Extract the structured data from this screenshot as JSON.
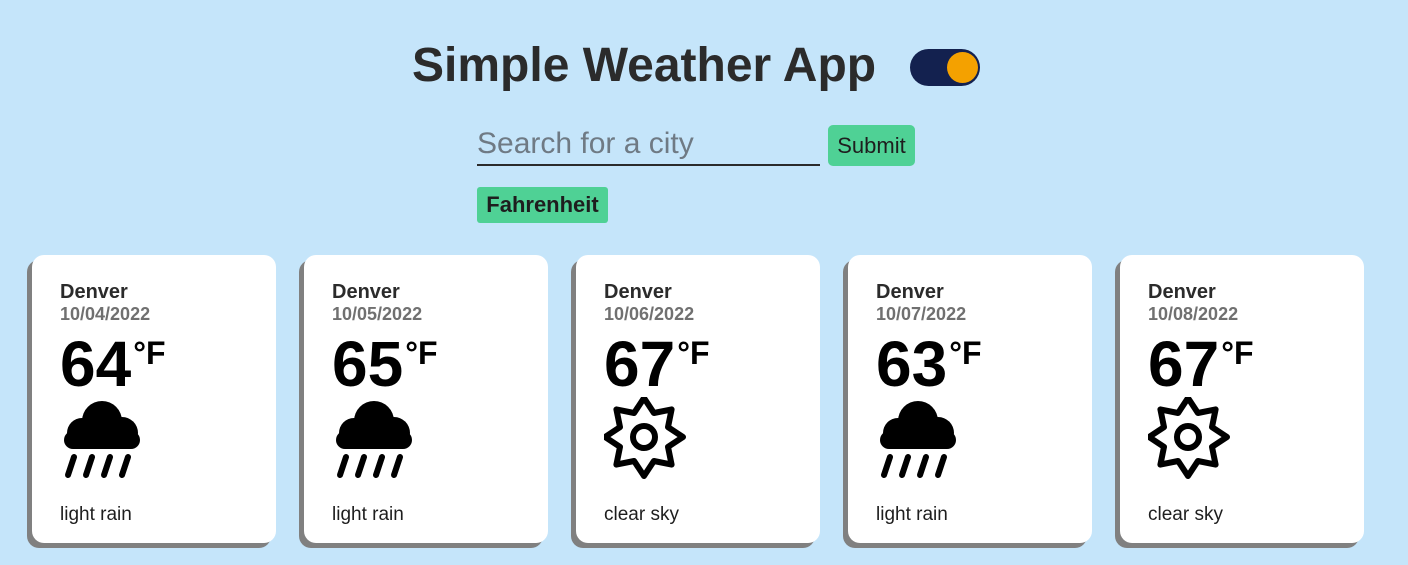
{
  "header": {
    "title": "Simple Weather App"
  },
  "search": {
    "placeholder": "Search for a city",
    "value": "",
    "submit_label": "Submit"
  },
  "unit_toggle": {
    "label": "Fahrenheit"
  },
  "theme_toggle": {
    "track_color": "#13214f",
    "knob_color": "#f4a100",
    "state": "on"
  },
  "colors": {
    "background": "#c5e5fa",
    "accent": "#4fd195"
  },
  "forecast": [
    {
      "city": "Denver",
      "date": "10/04/2022",
      "temp": "64",
      "unit": "°F",
      "icon": "rain-cloud-icon",
      "description": "light rain"
    },
    {
      "city": "Denver",
      "date": "10/05/2022",
      "temp": "65",
      "unit": "°F",
      "icon": "rain-cloud-icon",
      "description": "light rain"
    },
    {
      "city": "Denver",
      "date": "10/06/2022",
      "temp": "67",
      "unit": "°F",
      "icon": "sun-icon",
      "description": "clear sky"
    },
    {
      "city": "Denver",
      "date": "10/07/2022",
      "temp": "63",
      "unit": "°F",
      "icon": "rain-cloud-icon",
      "description": "light rain"
    },
    {
      "city": "Denver",
      "date": "10/08/2022",
      "temp": "67",
      "unit": "°F",
      "icon": "sun-icon",
      "description": "clear sky"
    }
  ]
}
